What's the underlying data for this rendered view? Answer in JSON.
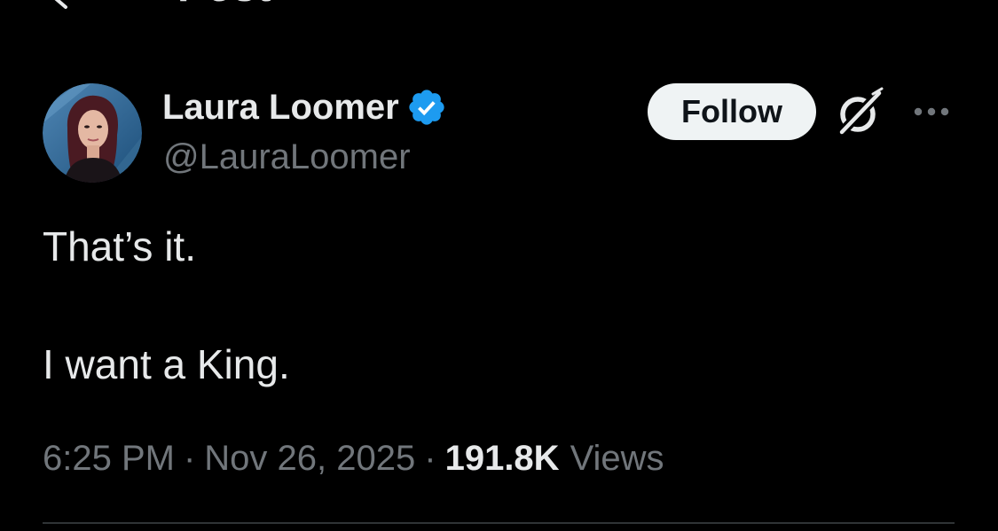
{
  "header": {
    "title": "Post"
  },
  "author": {
    "display_name": "Laura Loomer",
    "handle": "@LauraLoomer",
    "verified": true,
    "verified_color": "#1d9bf0",
    "avatar_icon": "avatar"
  },
  "actions": {
    "follow_label": "Follow",
    "grok_icon": "grok-icon",
    "more_icon": "more-icon"
  },
  "post": {
    "line_1": "That’s it.",
    "line_2": "I want a King."
  },
  "meta": {
    "time": "6:25 PM",
    "separator": "·",
    "date": "Nov 26, 2025",
    "views_count": "191.8K",
    "views_label": "Views"
  },
  "colors": {
    "background": "#000000",
    "primary_text": "#e7e9ea",
    "secondary_text": "#71767b",
    "follow_bg": "#eff3f4",
    "divider": "#2f3336"
  }
}
